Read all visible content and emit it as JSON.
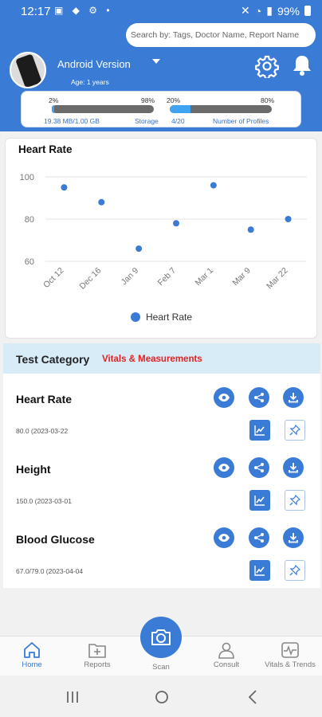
{
  "status_bar": {
    "time": "12:17",
    "battery": "99%"
  },
  "search": {
    "placeholder": "Search by: Tags, Doctor Name, Report Name"
  },
  "profile": {
    "name": "Android Version",
    "age": "Age: 1 years"
  },
  "storage": {
    "used_pct": "2%",
    "free_pct": "98%",
    "used_fraction": 0.02,
    "amount": "19.38 MB/1.00 GB",
    "label": "Storage"
  },
  "profiles": {
    "used_pct": "20%",
    "free_pct": "80%",
    "used_fraction": 0.2,
    "count": "4/20",
    "label": "Number of Profiles"
  },
  "chart_card": {
    "title": "Heart Rate"
  },
  "chart_data": {
    "type": "scatter",
    "categories": [
      "Oct 12",
      "Dec 16",
      "Jan 9",
      "Feb 7",
      "Mar 1",
      "Mar 9",
      "Mar 22"
    ],
    "series": [
      {
        "name": "Heart Rate",
        "values": [
          95,
          88,
          66,
          78,
          96,
          75,
          80
        ]
      }
    ],
    "yticks": [
      "100",
      "80",
      "60"
    ],
    "ylim": [
      60,
      100
    ],
    "legend": "bottom-center",
    "grid": true,
    "color": "#3a7bd5"
  },
  "test_category": {
    "label": "Test Category",
    "value": "Vitals & Measurements"
  },
  "items": [
    {
      "title": "Heart Rate",
      "value": "80.0 (2023-03-22"
    },
    {
      "title": "Height",
      "value": "150.0 (2023-03-01"
    },
    {
      "title": "Blood Glucose",
      "value": "67.0/79.0 (2023-04-04"
    }
  ],
  "nav": {
    "home": "Home",
    "reports": "Reports",
    "scan": "Scan",
    "consult": "Consult",
    "vitals": "Vitals & Trends"
  }
}
